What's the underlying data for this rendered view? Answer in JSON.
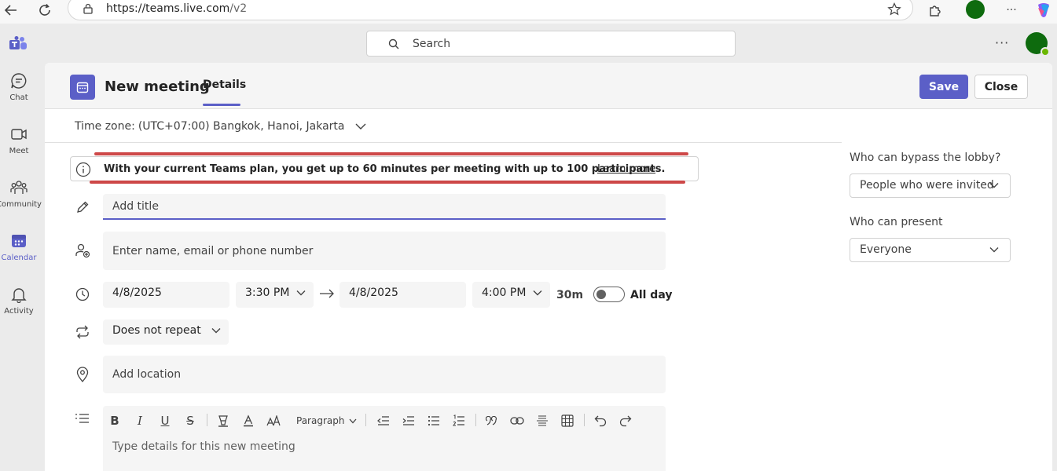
{
  "browser": {
    "url_host": "https://teams.live.com",
    "url_path": "/v2"
  },
  "header": {
    "search_placeholder": "Search",
    "more_label": "···"
  },
  "rail": {
    "items": [
      {
        "label": "Chat",
        "icon": "chat-icon"
      },
      {
        "label": "Meet",
        "icon": "video-camera-icon"
      },
      {
        "label": "Community",
        "icon": "people-community-icon"
      },
      {
        "label": "Calendar",
        "icon": "calendar-icon",
        "active": true
      },
      {
        "label": "Activity",
        "icon": "bell-icon"
      }
    ]
  },
  "meeting": {
    "title": "New meeting",
    "tab_details": "Details",
    "save_label": "Save",
    "close_label": "Close",
    "timezone_label": "Time zone:",
    "timezone_value": "(UTC+07:00) Bangkok, Hanoi, Jakarta",
    "banner_text": "With your current Teams plan, you get up to 60 minutes per meeting with up to 100 participants.",
    "banner_link": "Learn more",
    "title_placeholder": "Add title",
    "attendees_placeholder": "Enter name, email or phone number",
    "start_date": "4/8/2025",
    "start_time": "3:30 PM",
    "end_date": "4/8/2025",
    "end_time": "4:00 PM",
    "duration": "30m",
    "all_day_label": "All day",
    "repeat": "Does not repeat",
    "location_placeholder": "Add location",
    "paragraph_label": "Paragraph",
    "details_placeholder": "Type details for this new meeting"
  },
  "options": {
    "bypass_label": "Who can bypass the lobby?",
    "bypass_value": "People who were invited",
    "present_label": "Who can present",
    "present_value": "Everyone"
  },
  "colors": {
    "accent": "#5b5fc7",
    "annotation": "#c62828"
  }
}
